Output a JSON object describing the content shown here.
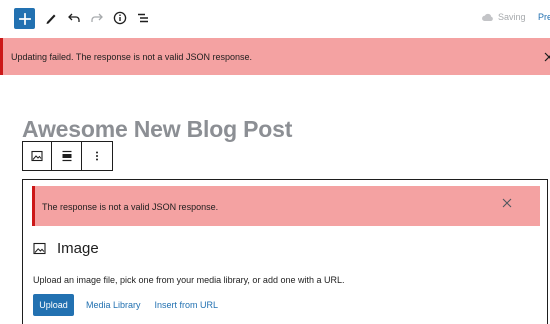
{
  "toolbar": {
    "add_icon": "plus-icon",
    "tools_icon": "pencil-icon",
    "undo_icon": "undo-icon",
    "redo_icon": "redo-icon",
    "info_icon": "info-icon",
    "outline_icon": "list-view-icon",
    "saving_label": "Saving",
    "preview_label": "Pre"
  },
  "notice": {
    "text": "Updating failed. The response is not a valid JSON response."
  },
  "post": {
    "title": "Awesome New Blog Post"
  },
  "block": {
    "error_text": "The response is not a valid JSON response.",
    "heading": "Image",
    "description": "Upload an image file, pick one from your media library, or add one with a URL.",
    "upload_label": "Upload",
    "media_library_label": "Media Library",
    "insert_url_label": "Insert from URL"
  },
  "colors": {
    "accent": "#2271b1",
    "error_bg": "#f4a2a2",
    "error_border": "#cc1818",
    "title_gray": "#8c8f94"
  }
}
